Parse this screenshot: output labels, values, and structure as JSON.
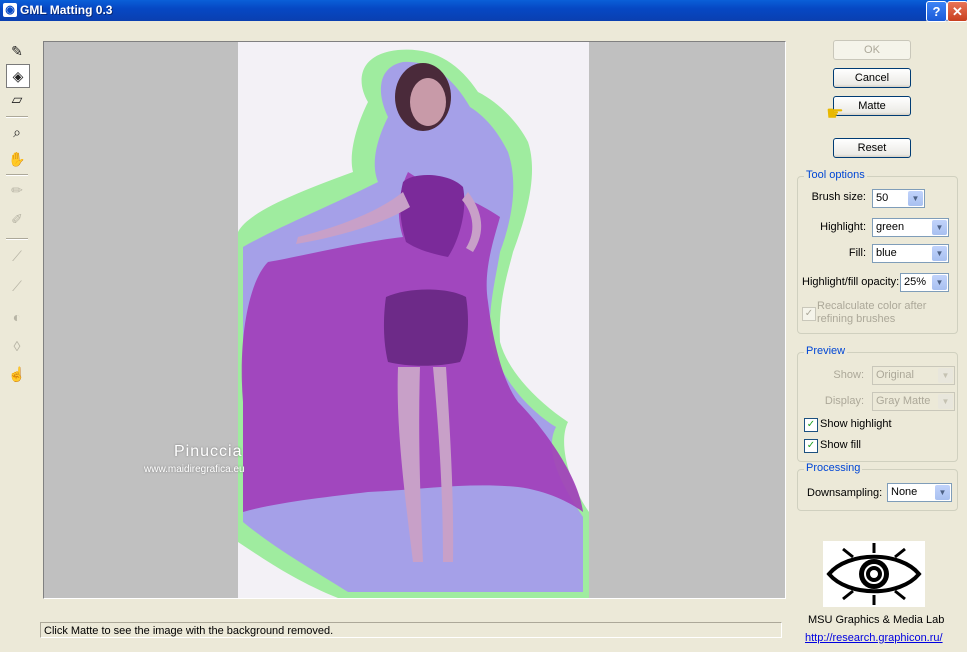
{
  "window": {
    "title": "GML Matting 0.3",
    "help_label": "?",
    "close_label": "✕"
  },
  "tools": [
    {
      "name": "brush-tool",
      "icon": "pen-icon",
      "glyph": "✎",
      "state": "normal"
    },
    {
      "name": "fill-tool",
      "icon": "paint-bucket-icon",
      "glyph": "◈",
      "state": "active"
    },
    {
      "name": "eraser-tool",
      "icon": "eraser-icon",
      "glyph": "▱",
      "state": "normal"
    },
    {
      "name": "zoom-tool",
      "icon": "magnifier-icon",
      "glyph": "⌕",
      "state": "normal"
    },
    {
      "name": "hand-tool",
      "icon": "hand-icon",
      "glyph": "✋",
      "state": "normal"
    },
    {
      "name": "pencil-tool",
      "icon": "pencil-icon",
      "glyph": "✏",
      "state": "disabled"
    },
    {
      "name": "pencil-alt-tool",
      "icon": "pencil-alt-icon",
      "glyph": "✐",
      "state": "disabled"
    },
    {
      "name": "refine-brush-tool",
      "icon": "brush-icon",
      "glyph": "⟋",
      "state": "disabled"
    },
    {
      "name": "refine-brush-alt-tool",
      "icon": "brush-alt-icon",
      "glyph": "⟋",
      "state": "disabled"
    },
    {
      "name": "contrast-tool",
      "icon": "contrast-icon",
      "glyph": "◐",
      "state": "disabled"
    },
    {
      "name": "blur-tool",
      "icon": "drop-icon",
      "glyph": "◊",
      "state": "disabled"
    },
    {
      "name": "smudge-tool",
      "icon": "smudge-icon",
      "glyph": "☝",
      "state": "disabled"
    }
  ],
  "watermark": {
    "name": "Pinuccia",
    "url": "www.maidiregrafica.eu"
  },
  "buttons": {
    "ok": "OK",
    "cancel": "Cancel",
    "matte": "Matte",
    "reset": "Reset"
  },
  "tool_options": {
    "title": "Tool options",
    "brush_size_label": "Brush size:",
    "brush_size_value": "50",
    "highlight_label": "Highlight:",
    "highlight_value": "green",
    "fill_label": "Fill:",
    "fill_value": "blue",
    "opacity_label": "Highlight/fill opacity:",
    "opacity_value": "25%",
    "recalc_label_1": "Recalculate color after",
    "recalc_label_2": "refining brushes",
    "recalc_checked": true
  },
  "preview": {
    "title": "Preview",
    "show_label": "Show:",
    "show_value": "Original",
    "display_label": "Display:",
    "display_value": "Gray Matte",
    "show_highlight_label": "Show highlight",
    "show_highlight_checked": true,
    "show_fill_label": "Show fill",
    "show_fill_checked": true
  },
  "processing": {
    "title": "Processing",
    "downsampling_label": "Downsampling:",
    "downsampling_value": "None"
  },
  "status": "Click Matte to see the image with the background removed.",
  "lab": {
    "name": "MSU Graphics & Media Lab",
    "url": "http://research.graphicon.ru/"
  },
  "colors": {
    "highlight": "#9fec9f",
    "fill": "#a5a0e8",
    "dress": "#a13fba",
    "accent": "#0046d5"
  }
}
